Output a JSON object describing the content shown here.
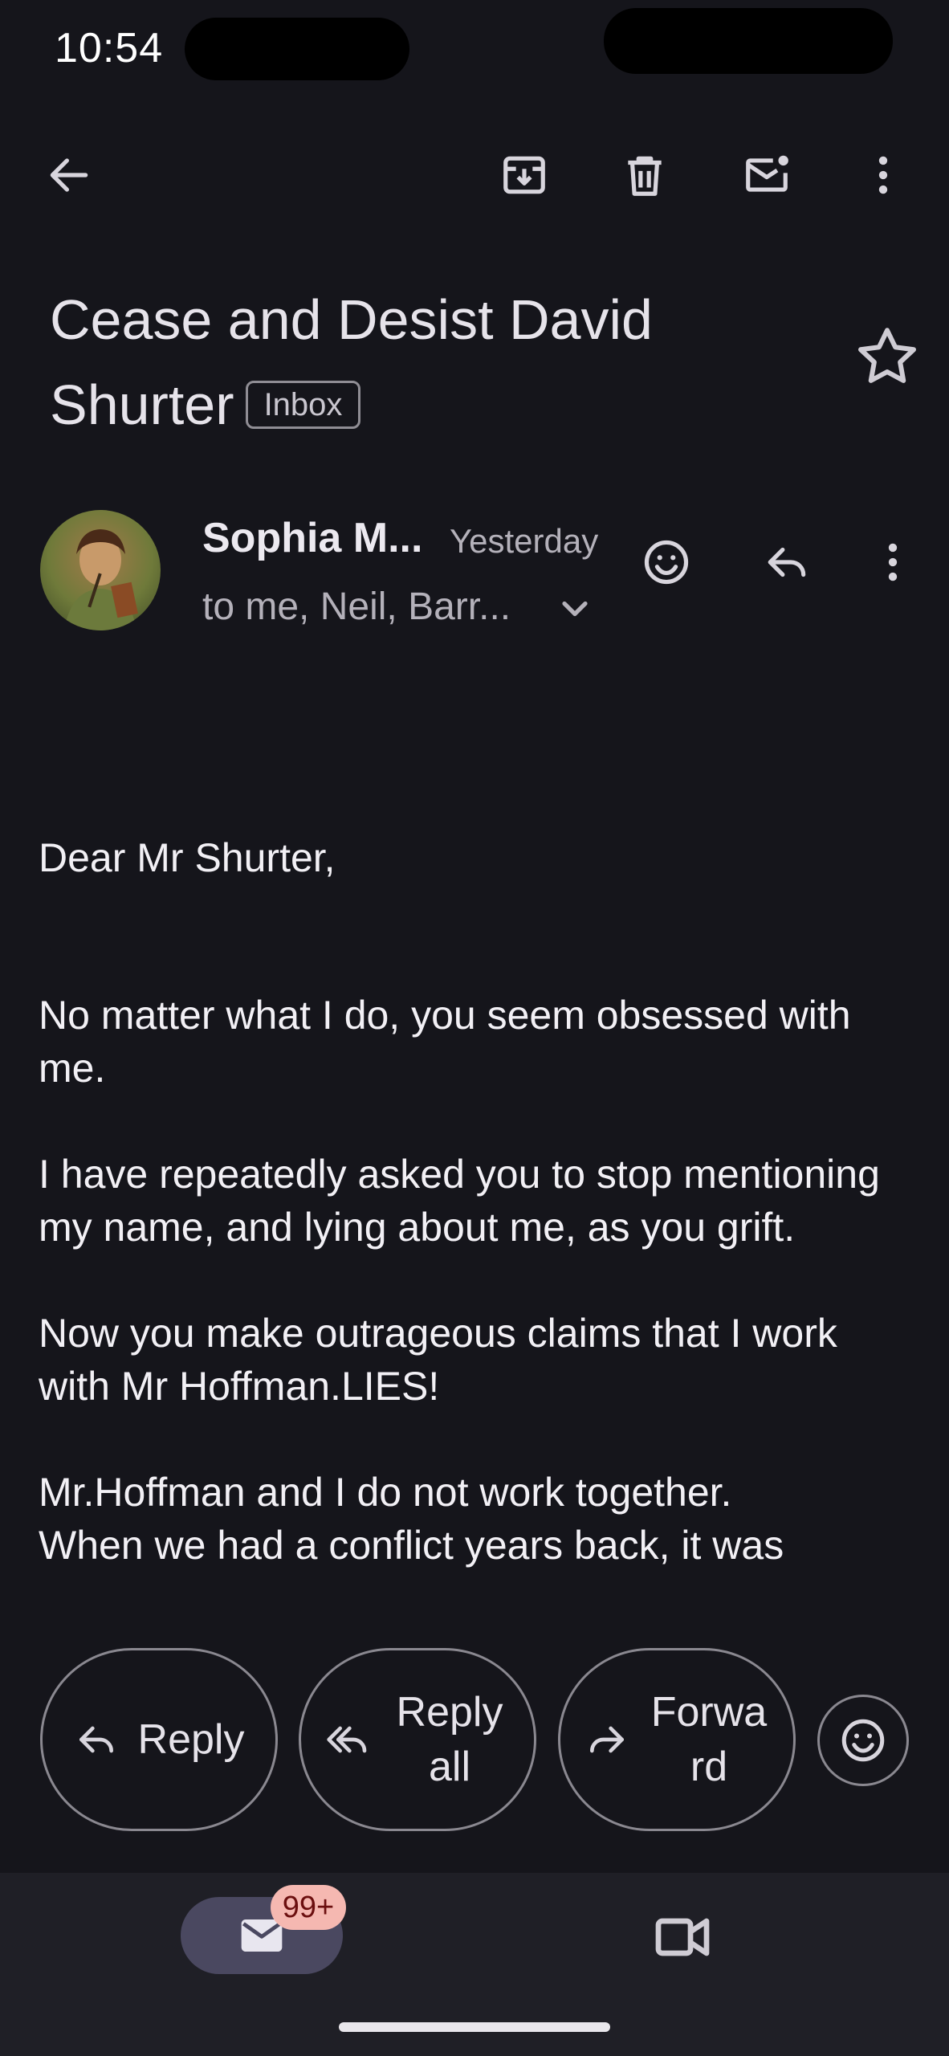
{
  "status_bar": {
    "time": "10:54"
  },
  "app_bar": {
    "back_icon": "arrow-left-icon",
    "actions": [
      "archive-icon",
      "delete-icon",
      "mark-unread-icon",
      "more-vert-icon"
    ]
  },
  "email": {
    "subject": "Cease and Desist David Shurter",
    "label": "Inbox",
    "sender": {
      "name": "Sophia M...",
      "time": "Yesterday",
      "recipients": "to me, Neil, Barr..."
    },
    "body": [
      "Dear Mr Shurter,",
      "No matter what I do, you seem obsessed with me.",
      "I have repeatedly asked you to stop mentioning my name, and lying about me, as you grift.",
      "Now you make outrageous claims that I work with Mr Hoffman.LIES!",
      "Mr.Hoffman and I do not work together.",
      "When we had a conflict years back, it was"
    ]
  },
  "actions": {
    "reply": "Reply",
    "reply_all_1": "Reply",
    "reply_all_2": "all",
    "forward_1": "Forwa",
    "forward_2": "rd"
  },
  "bottom_nav": {
    "mail_badge": "99+"
  },
  "colors": {
    "background": "#15151b",
    "nav_background": "#1f1f26",
    "active_pill": "#4a4860",
    "badge": "#f5b8b1"
  }
}
